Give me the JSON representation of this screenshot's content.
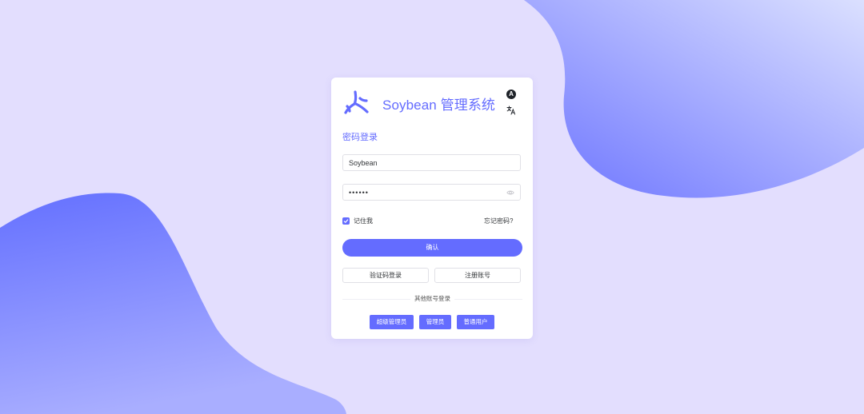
{
  "header": {
    "title": "Soybean 管理系统",
    "theme_toggle_label": "A",
    "icons": [
      "soybean-logo-icon",
      "theme-toggle-icon",
      "language-icon"
    ]
  },
  "login": {
    "section_title": "密码登录",
    "username_value": "Soybean",
    "password_value": "••••••",
    "remember_me_label": "记住我",
    "remember_me_checked": true,
    "forgot_password_label": "忘记密码?",
    "confirm_button_label": "确认",
    "code_login_button_label": "验证码登录",
    "register_button_label": "注册账号",
    "other_login_label": "其他账号登录",
    "roles": [
      "超级管理员",
      "管理员",
      "普通用户"
    ]
  },
  "colors": {
    "primary": "#646cff",
    "background": "#e3defe",
    "card": "#ffffff"
  }
}
